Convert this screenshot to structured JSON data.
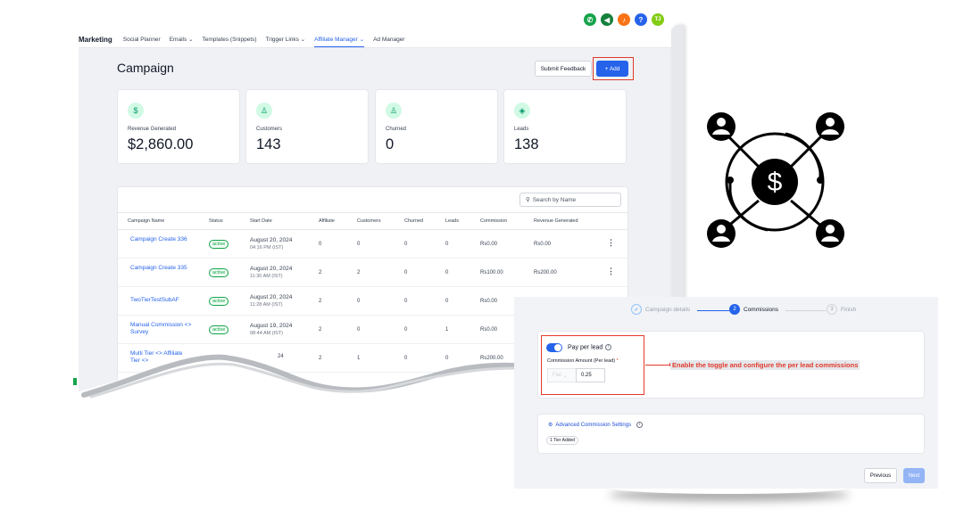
{
  "nav": {
    "brand": "Marketing",
    "items": [
      "Social Planner",
      "Emails ⌄",
      "Templates (Snippets)",
      "Trigger Links ⌄",
      "Affiliate Manager ⌄",
      "Ad Manager"
    ]
  },
  "top_icons": [
    {
      "name": "phone-icon",
      "glyph": "✆",
      "color": "#16a34a"
    },
    {
      "name": "megaphone-icon",
      "glyph": "◀",
      "color": "#15803d"
    },
    {
      "name": "bell-icon",
      "glyph": "♪",
      "color": "#f97316"
    },
    {
      "name": "help-icon",
      "glyph": "?",
      "color": "#2563eb"
    },
    {
      "name": "user-avatar",
      "glyph": "TJ",
      "color": "#84cc16"
    }
  ],
  "page": {
    "title": "Campaign",
    "feedback_label": "Submit Feedback",
    "add_label": "+ Add"
  },
  "cards": [
    {
      "icon": "$",
      "label": "Revenue Generated",
      "value": "$2,860.00"
    },
    {
      "icon": "♙",
      "label": "Customers",
      "value": "143"
    },
    {
      "icon": "♙",
      "label": "Churned",
      "value": "0"
    },
    {
      "icon": "◈",
      "label": "Leads",
      "value": "138"
    }
  ],
  "table": {
    "search_placeholder": "Search by Name",
    "headers": [
      "Campaign Name",
      "Status",
      "Start Date",
      "Affiliate",
      "Customers",
      "Churned",
      "Leads",
      "Commission",
      "Revenue Generated"
    ],
    "rows": [
      {
        "name": "Campaign Create 336",
        "status": "active",
        "date": "August 20, 2024",
        "time": "04:16 PM (IST)",
        "affiliate": "0",
        "customers": "0",
        "churned": "0",
        "leads": "0",
        "commission": "Rs0.00",
        "revenue": "Rs0.00"
      },
      {
        "name": "Campaign Create 335",
        "status": "active",
        "date": "August 20, 2024",
        "time": "11:30 AM (IST)",
        "affiliate": "2",
        "customers": "2",
        "churned": "0",
        "leads": "0",
        "commission": "Rs100.00",
        "revenue": "Rs200.00"
      },
      {
        "name": "TwoTierTestSubAF",
        "status": "active",
        "date": "August 20, 2024",
        "time": "11:28 AM (IST)",
        "affiliate": "2",
        "customers": "0",
        "churned": "0",
        "leads": "0",
        "commission": "Rs0.00",
        "revenue": ""
      },
      {
        "name": "Manual Commission <> Survey",
        "status": "active",
        "date": "August 19, 2024",
        "time": "08:44 AM (IST)",
        "affiliate": "2",
        "customers": "0",
        "churned": "0",
        "leads": "1",
        "commission": "Rs0.00",
        "revenue": ""
      },
      {
        "name": "Multi Tier <> Affiliate Tier <>",
        "status": "",
        "date": "24",
        "time": "",
        "affiliate": "2",
        "customers": "1",
        "churned": "0",
        "leads": "0",
        "commission": "Rs200.00",
        "revenue": ""
      }
    ]
  },
  "wizard": {
    "steps": [
      {
        "num": "✓",
        "label": "Campaign details"
      },
      {
        "num": "2",
        "label": "Commissions"
      },
      {
        "num": "3",
        "label": "Finish"
      }
    ],
    "toggle_label": "Pay per lead",
    "amount_label": "Commission Amount (Per lead)",
    "required_mark": "*",
    "type_value": "Flat",
    "amount_value": "0.25",
    "annotation": "Enable the toggle and configure the per lead commissions",
    "advanced_label": "Advanced Commission Settings",
    "tier_badge": "1 Tier Added",
    "prev_label": "Previous",
    "next_label": "Next"
  },
  "colors": {
    "accent": "#2563eb",
    "highlight": "#e23a2b",
    "success": "#16a34a"
  }
}
